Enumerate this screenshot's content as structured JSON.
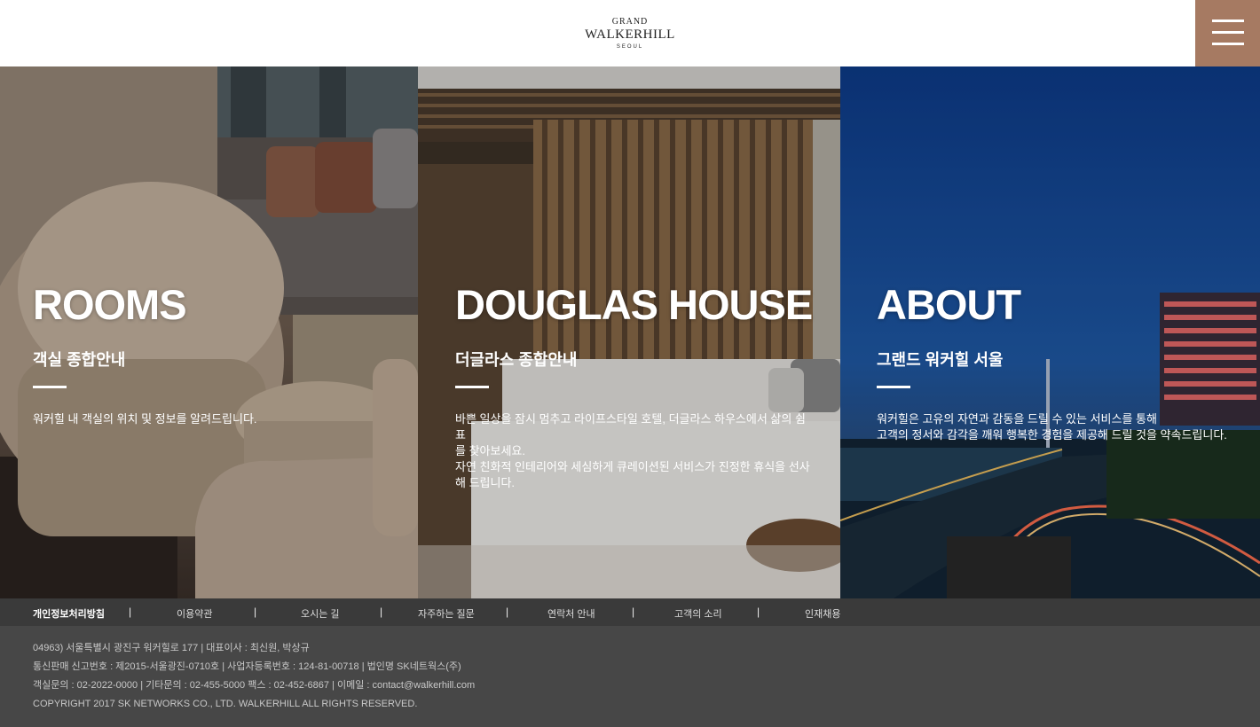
{
  "header": {
    "logo": {
      "line1": "GRAND",
      "line2": "WALKERHILL",
      "line3": "SEOUL"
    }
  },
  "panels": [
    {
      "title": "ROOMS",
      "subtitle": "객실 종합안내",
      "description": [
        "워커힐 내 객실의 위치 및 정보를 알려드립니다."
      ]
    },
    {
      "title": "DOUGLAS HOUSE",
      "subtitle": "더글라스 종합안내",
      "description": [
        "바쁜 일상을 잠시 멈추고 라이프스타일 호텔, 더글라스 하우스에서 삶의 쉼표",
        "를 찾아보세요.",
        "자연 친화적 인테리어와 세심하게 큐레이션된 서비스가 진정한 휴식을 선사",
        "해 드립니다."
      ]
    },
    {
      "title": "ABOUT",
      "subtitle": "그랜드 워커힐 서울",
      "description": [
        "워커힐은 고유의 자연과 감동을 드릴 수 있는 서비스를 통해",
        "고객의 정서와 감각을 깨워 행복한 경험을 제공해 드릴 것을 약속드립니다."
      ]
    }
  ],
  "footer": {
    "nav": [
      "개인정보처리방침",
      "이용약관",
      "오시는 길",
      "자주하는 질문",
      "연락처 안내",
      "고객의 소리",
      "인재채용"
    ],
    "separator": "|",
    "info": [
      "04963) 서울특별시 광진구 워커힐로 177 | 대표이사 : 최신원, 박상규",
      "통신판매 신고번호 : 제2015-서울광진-0710호 | 사업자등록번호 : 124-81-00718 | 법인명 SK네트웍스(주)",
      "객실문의 : 02-2022-0000 | 기타문의 : 02-455-5000 팩스 : 02-452-6867 | 이메일 : contact@walkerhill.com",
      "COPYRIGHT 2017 SK NETWORKS CO., LTD. WALKERHILL ALL RIGHTS RESERVED."
    ]
  },
  "colors": {
    "menu_accent": "#a67a62",
    "footer_bg": "#474747",
    "footer_nav_bg": "#3a3a3a"
  }
}
